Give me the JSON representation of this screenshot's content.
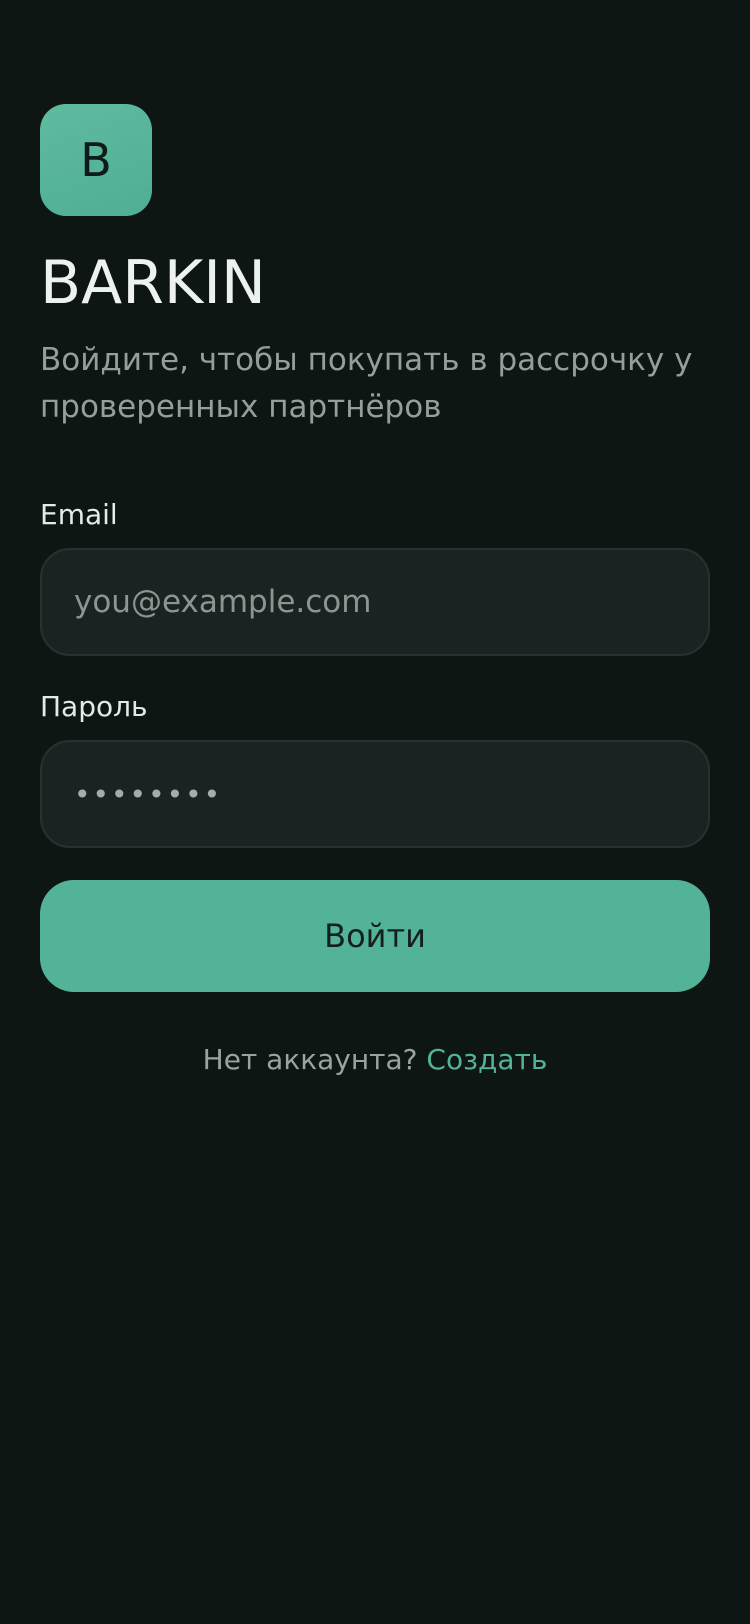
{
  "logo": {
    "letter": "B"
  },
  "app": {
    "title": "BARKIN",
    "subtitle": "Войдите, чтобы покупать в рассрочку у проверенных партнёров"
  },
  "form": {
    "email": {
      "label": "Email",
      "value": "",
      "placeholder": "you@example.com"
    },
    "password": {
      "label": "Пароль",
      "value": "••••••••",
      "placeholder": ""
    },
    "submit_label": "Войти"
  },
  "signup": {
    "prompt": "Нет аккаунта?",
    "link_label": "Создать"
  },
  "colors": {
    "background": "#0e1614",
    "accent": "#53b398",
    "input_bg": "#1a2322"
  }
}
